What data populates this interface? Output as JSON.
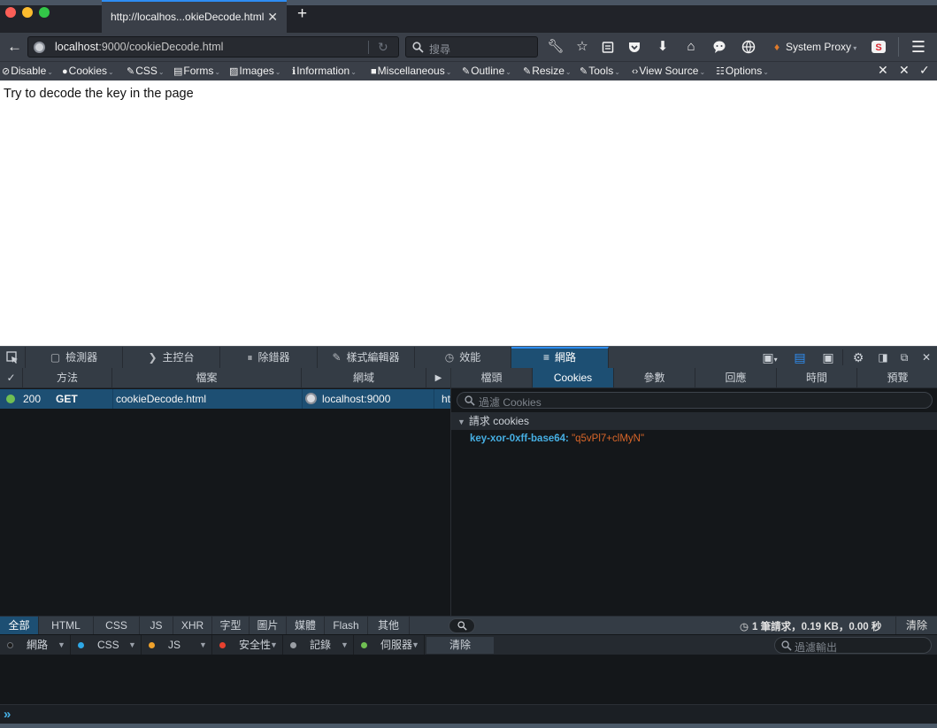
{
  "tab": {
    "title": "http://localhos...okieDecode.html",
    "close": "✕",
    "new_tab": "+"
  },
  "nav": {
    "url_host": "localhost",
    "url_rest": ":9000/cookieDecode.html",
    "search_placeholder": "搜尋",
    "system_proxy": "System Proxy"
  },
  "webdev": {
    "items": [
      {
        "label": "Disable"
      },
      {
        "label": "Cookies"
      },
      {
        "label": "CSS"
      },
      {
        "label": "Forms"
      },
      {
        "label": "Images"
      },
      {
        "label": "Information"
      },
      {
        "label": "Miscellaneous"
      },
      {
        "label": "Outline"
      },
      {
        "label": "Resize"
      },
      {
        "label": "Tools"
      },
      {
        "label": "View Source"
      },
      {
        "label": "Options"
      }
    ]
  },
  "page": {
    "text": "Try to decode the key in the page"
  },
  "devtools": {
    "tabs": [
      "檢測器",
      "主控台",
      "除錯器",
      "樣式編輯器",
      "效能",
      "網路"
    ],
    "active_tab": "網路"
  },
  "network": {
    "columns": [
      "✓",
      "方法",
      "檔案",
      "網域"
    ],
    "requests": [
      {
        "status": "200",
        "method": "GET",
        "file": "cookieDecode.html",
        "domain": "localhost:9000",
        "type_prefix": "ht"
      }
    ]
  },
  "detail": {
    "tabs": [
      "檔頭",
      "Cookies",
      "參數",
      "回應",
      "時間",
      "預覽"
    ],
    "active_tab": "Cookies",
    "filter_placeholder": "過濾 Cookies",
    "section_title": "請求 cookies",
    "cookie_key": "key-xor-0xff-base64:",
    "cookie_value": "\"q5vPl7+clMyN\""
  },
  "filters": {
    "buttons": [
      "全部",
      "HTML",
      "CSS",
      "JS",
      "XHR",
      "字型",
      "圖片",
      "媒體",
      "Flash",
      "其他"
    ],
    "summary": "1 筆請求，0.19 KB，0.00 秒",
    "clear": "清除"
  },
  "console": {
    "categories": [
      {
        "label": "網路",
        "color": "#1b1b1b"
      },
      {
        "label": "CSS",
        "color": "#2ea8e6"
      },
      {
        "label": "JS",
        "color": "#f0a22b"
      },
      {
        "label": "安全性",
        "color": "#e8412f"
      },
      {
        "label": "記錄",
        "color": "#9a9ea4"
      },
      {
        "label": "伺服器",
        "color": "#70bf53"
      }
    ],
    "clear": "清除",
    "filter_placeholder": "過濾輸出",
    "prompt": "»"
  },
  "colors": {
    "accent": "#1d4f73",
    "cookie_key": "#46afe3",
    "cookie_value": "#d96629"
  }
}
